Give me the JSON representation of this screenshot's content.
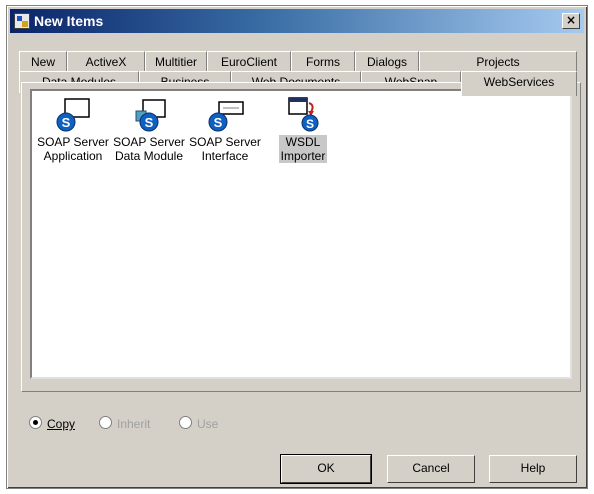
{
  "window": {
    "title": "New Items",
    "close_glyph": "×"
  },
  "tabs_row1": [
    "New",
    "ActiveX",
    "Multitier",
    "EuroClient",
    "Forms",
    "Dialogs",
    "Projects"
  ],
  "tabs_row2": [
    "Data Modules",
    "Business",
    "Web Documents",
    "WebSnap",
    "WebServices"
  ],
  "active_tab": "WebServices",
  "items": [
    {
      "label": "SOAP Server\nApplication",
      "icon": "soap-server-application-icon"
    },
    {
      "label": "SOAP Server\nData Module",
      "icon": "soap-server-data-module-icon"
    },
    {
      "label": "SOAP Server\nInterface",
      "icon": "soap-server-interface-icon"
    },
    {
      "label": "WSDL\nImporter",
      "icon": "wsdl-importer-icon",
      "selected": true
    }
  ],
  "options": {
    "copy": {
      "label": "Copy",
      "checked": true,
      "enabled": true
    },
    "inherit": {
      "label": "Inherit",
      "checked": false,
      "enabled": false
    },
    "use": {
      "label": "Use",
      "checked": false,
      "enabled": false
    }
  },
  "buttons": {
    "ok": "OK",
    "cancel": "Cancel",
    "help": "Help"
  },
  "colors": {
    "titlebar_start": "#0a246a",
    "titlebar_end": "#a6caf0",
    "face": "#d4d0c8",
    "soap_blue": "#1060c0",
    "wsdl_red": "#c02020"
  }
}
